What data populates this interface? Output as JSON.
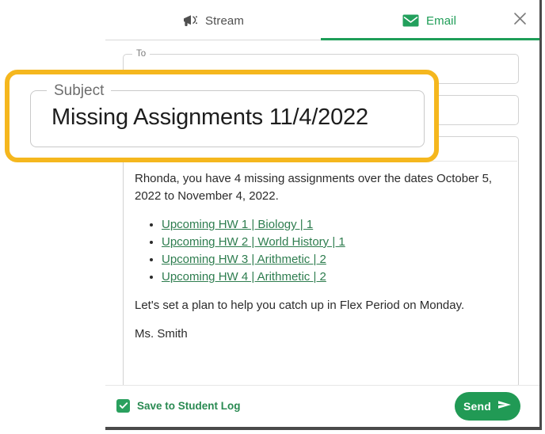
{
  "window": {
    "close_icon": "close-icon"
  },
  "tabs": [
    {
      "id": "stream",
      "label": "Stream",
      "icon": "megaphone-icon",
      "active": false
    },
    {
      "id": "email",
      "label": "Email",
      "icon": "envelope-icon",
      "active": true
    }
  ],
  "compose": {
    "to": {
      "legend": "To",
      "value": "",
      "placeholder": ""
    },
    "subject": {
      "legend": "Subject",
      "value": "Missing Assignments 11/4/2022",
      "placeholder": ""
    },
    "body": {
      "paragraph_1": "Rhonda, you have 4 missing assignments over the dates October 5, 2022 to November 4, 2022.",
      "links": [
        "Upcoming HW 1 | Biology | 1",
        "Upcoming HW 2 | World History | 1",
        "Upcoming HW 3 | Arithmetic | 2",
        "Upcoming HW 4 | Arithmetic | 2"
      ],
      "paragraph_2": "Let's set a plan to help you catch up in Flex Period on Monday.",
      "signature": "Ms. Smith"
    },
    "toolbar_icons": [
      "bold-icon",
      "italic-icon",
      "underline-icon",
      "link-icon",
      "image-icon"
    ]
  },
  "footer": {
    "save_to_log_label": "Save to Student Log",
    "save_to_log_checked": true,
    "send_label": "Send",
    "send_icon": "paper-plane-icon"
  },
  "callout": {
    "legend": "Subject",
    "value": "Missing Assignments 11/4/2022",
    "highlight_color": "#f5b71e"
  },
  "colors": {
    "accent_green": "#1e9e58",
    "link_green": "#2e7d4f",
    "highlight_yellow": "#f5b71e",
    "text": "#2b2b2b"
  }
}
